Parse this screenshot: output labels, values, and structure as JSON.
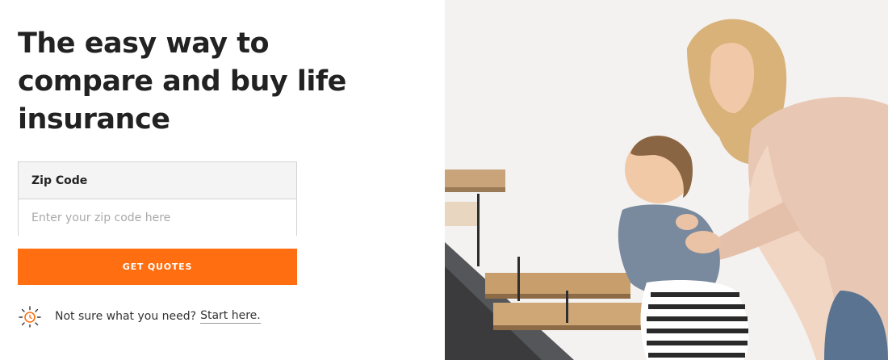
{
  "hero": {
    "headline_lines": [
      "The easy way to",
      "compare and buy life",
      "insurance"
    ]
  },
  "zip_form": {
    "label": "Zip Code",
    "placeholder": "Enter your zip code here",
    "value": ""
  },
  "cta": {
    "label": "GET QUOTES",
    "color": "#ff6e10"
  },
  "help": {
    "icon": "sun-icon",
    "text": "Not sure what you need?",
    "link_label": "Start here."
  }
}
